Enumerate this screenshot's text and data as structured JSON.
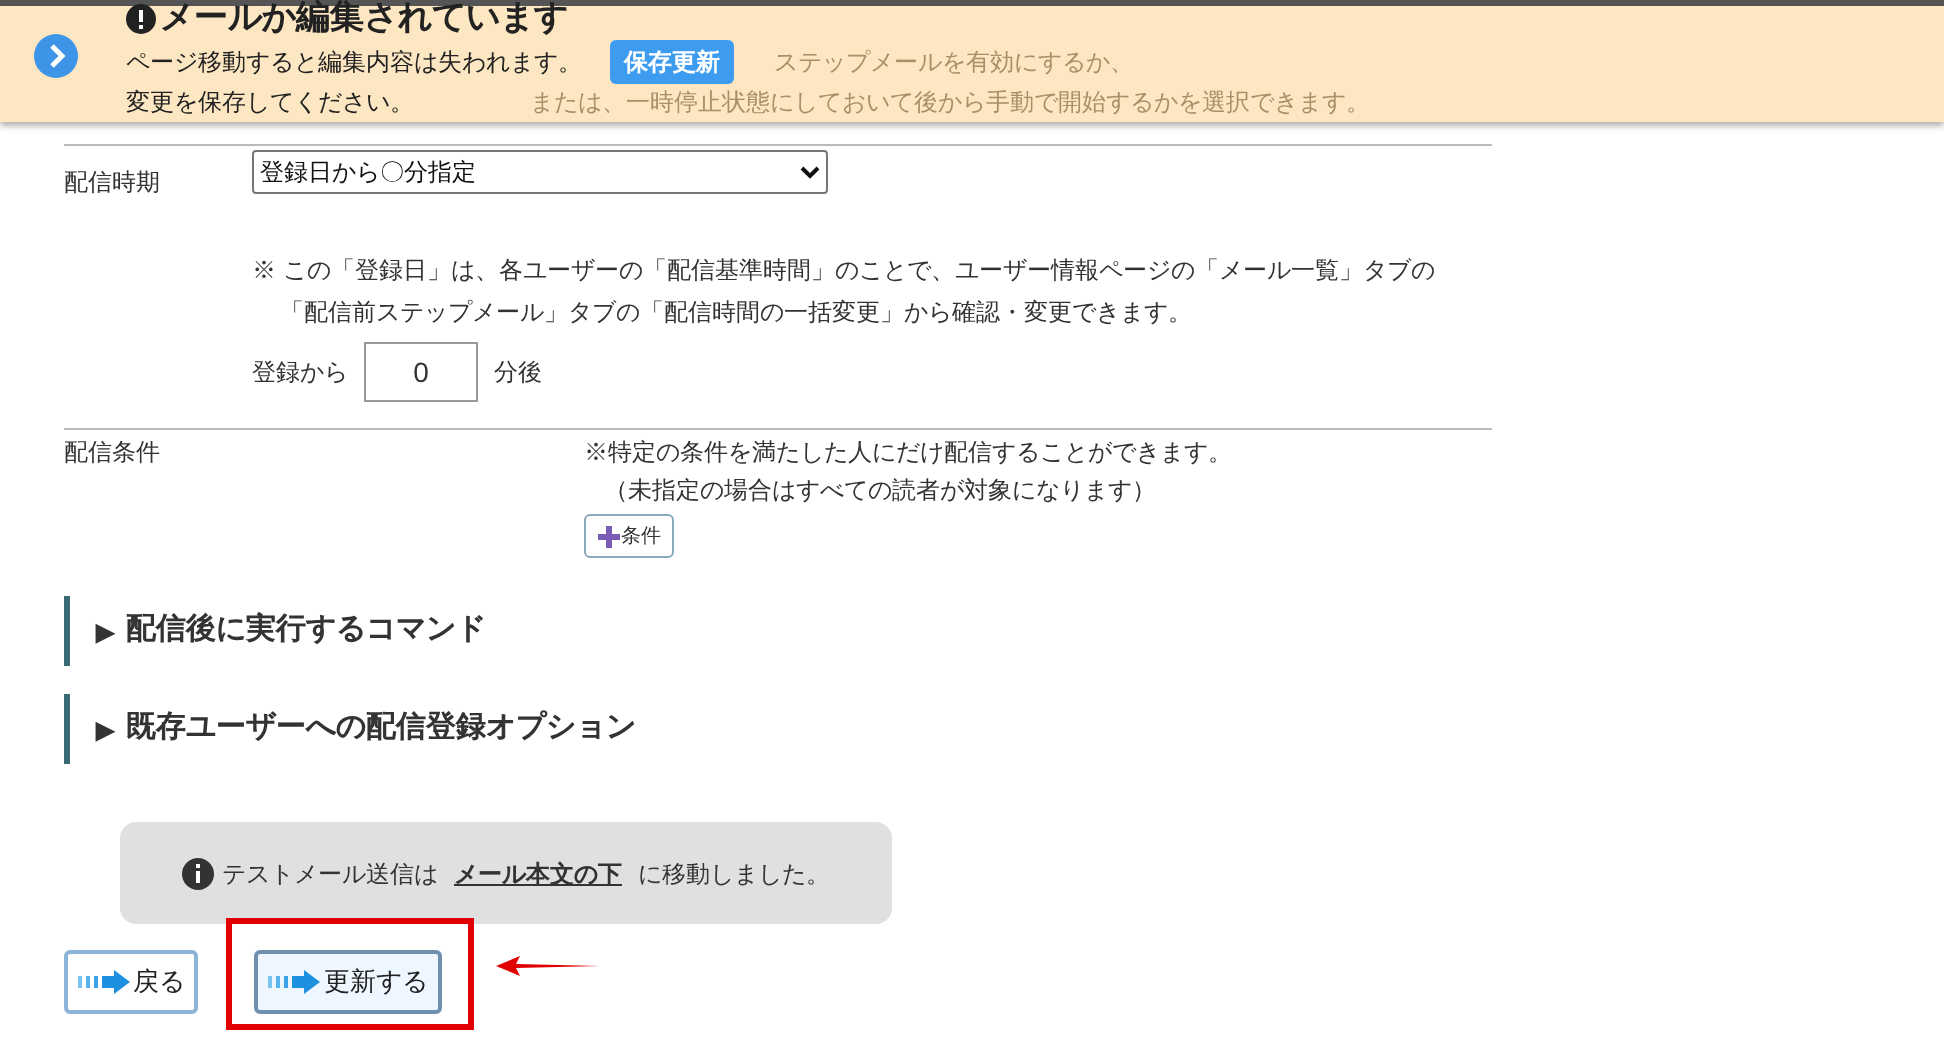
{
  "banner": {
    "title": "メールか編集されています",
    "message_lines": [
      "ページ移動すると編集内容は失われます。",
      "変更を保存してください。"
    ],
    "save_button": "保存更新",
    "background_lines": [
      "ステップメールを有効にするか、",
      "または、一時停止状態にしておいて後から手動で開始するかを選択できます。"
    ]
  },
  "delivery_timing": {
    "label": "配信時期",
    "select_value": "登録日から〇分指定",
    "note_lines": [
      "※ この「登録日」は、各ユーザーの「配信基準時間」のことで、ユーザー情報ページの「メール一覧」タブの",
      "「配信前ステップメール」タブの「配信時間の一括変更」から確認・変更できます。"
    ],
    "prefix": "登録から",
    "minutes": "0",
    "suffix": "分後"
  },
  "delivery_condition": {
    "label": "配信条件",
    "note_lines": [
      "※特定の条件を満たした人にだけ配信することができます。",
      "（未指定の場合はすべての読者が対象になります）"
    ],
    "add_button": "条件"
  },
  "sections": [
    {
      "marker": "▶",
      "label": "配信後に実行するコマンド"
    },
    {
      "marker": "▶",
      "label": "既存ユーザーへの配信登録オプション"
    }
  ],
  "info": {
    "before": "テストメール送信は",
    "link": "メール本文の下",
    "after": "に移動しました。"
  },
  "buttons": [
    {
      "label": "戻る",
      "highlighted": false
    },
    {
      "label": "更新する",
      "highlighted": true
    }
  ]
}
